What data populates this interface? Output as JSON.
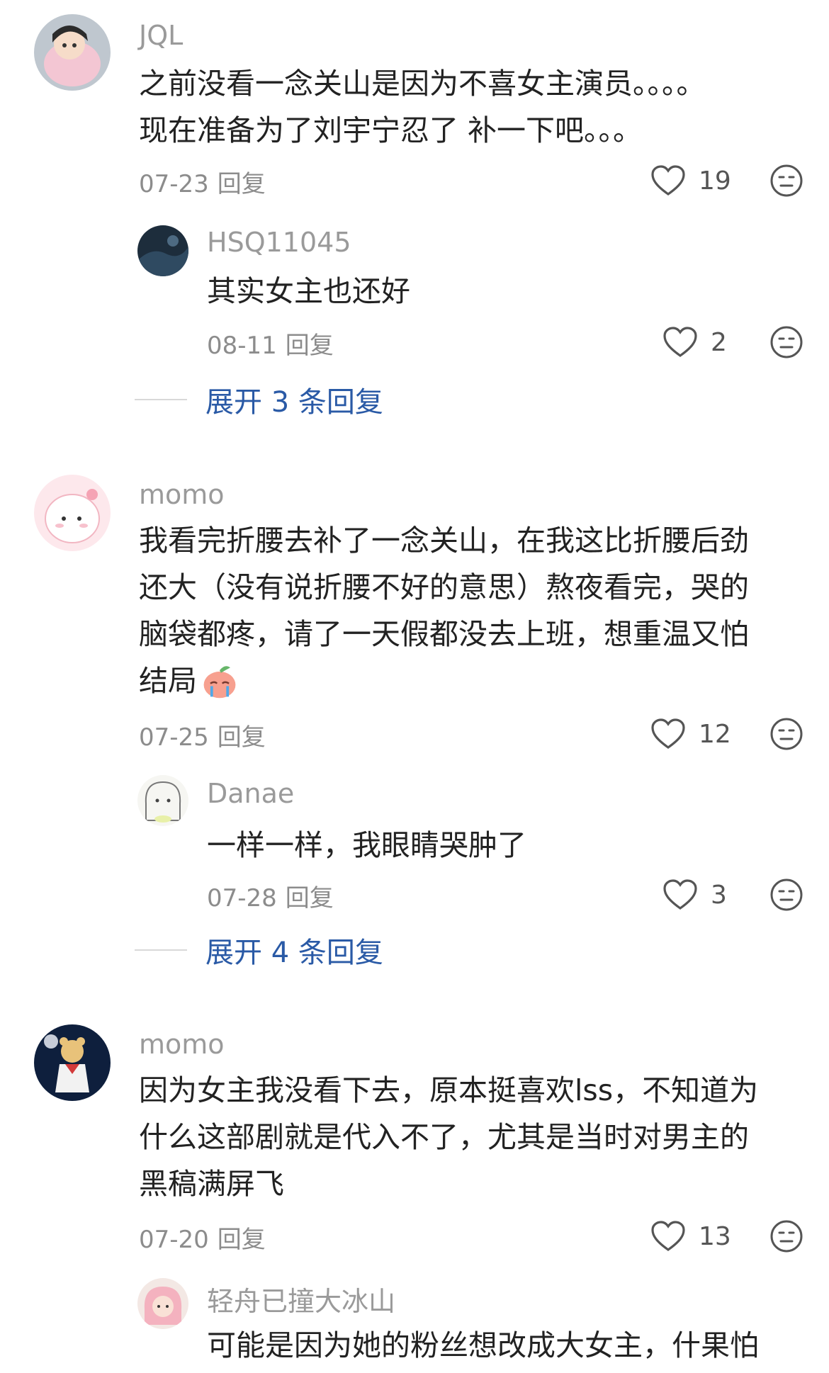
{
  "comments": [
    {
      "user": "JQL",
      "text": "之前没看一念关山是因为不喜女主演员。。。。\n现在准备为了刘宇宁忍了 补一下吧。。。",
      "date": "07-23",
      "reply_label": "回复",
      "likes": "19",
      "replies": [
        {
          "user": "HSQ11045",
          "text": "其实女主也还好",
          "date": "08-11",
          "reply_label": "回复",
          "likes": "2"
        }
      ],
      "expand_label": "展开 3 条回复"
    },
    {
      "user": "momo",
      "text": "我看完折腰去补了一念关山，在我这比折腰后劲\n还大（没有说折腰不好的意思）熬夜看完，哭的\n脑袋都疼，请了一天假都没去上班，想重温又怕\n结局",
      "date": "07-25",
      "reply_label": "回复",
      "likes": "12",
      "replies": [
        {
          "user": "Danae",
          "text": "一样一样，我眼睛哭肿了",
          "date": "07-28",
          "reply_label": "回复",
          "likes": "3"
        }
      ],
      "expand_label": "展开 4 条回复"
    },
    {
      "user": "momo",
      "text": "因为女主我没看下去，原本挺喜欢lss，不知道为\n什么这部剧就是代入不了，尤其是当时对男主的\n黑稿满屏飞",
      "date": "07-20",
      "reply_label": "回复",
      "likes": "13",
      "replies": [
        {
          "user": "轻舟已撞大冰山",
          "text": "可能是因为她的粉丝想改成大女主，什果怕"
        }
      ]
    }
  ],
  "icons": {
    "like": "heart-outline-icon",
    "dislike": "neutral-face-icon",
    "emoji_in_text": "crying-peach-emoji"
  },
  "colors": {
    "username": "#9a9a9a",
    "text": "#222222",
    "meta": "#8c8c8c",
    "expand_link": "#2a5aa6"
  }
}
